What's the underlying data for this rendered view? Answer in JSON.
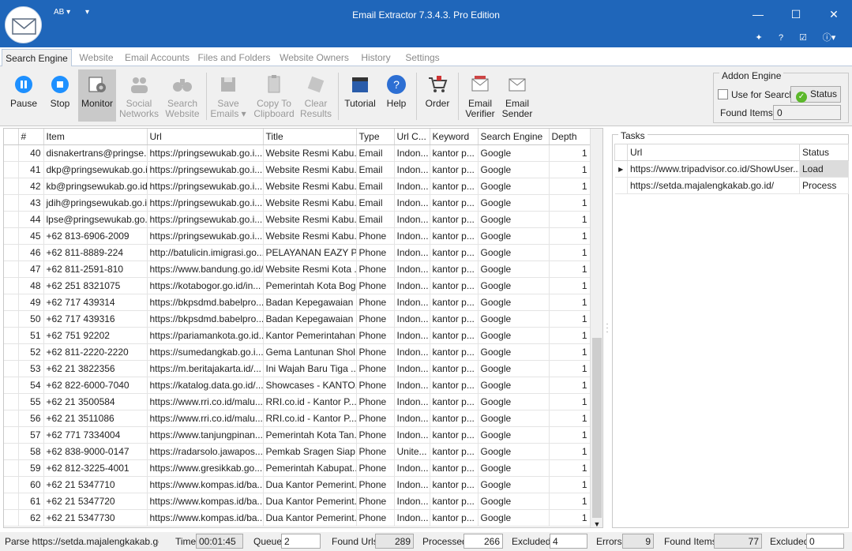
{
  "app": {
    "title": "Email Extractor 7.3.4.3. Pro Edition"
  },
  "titlebar": {
    "quick_access_1": "AB ▾",
    "quick_access_2": "▾",
    "minimize": "—",
    "maximize": "☐",
    "close": "✕"
  },
  "tabs": [
    {
      "label": "Search Engine"
    },
    {
      "label": "Website"
    },
    {
      "label": "Email Accounts"
    },
    {
      "label": "Files and Folders"
    },
    {
      "label": "Website Owners"
    },
    {
      "label": "History"
    },
    {
      "label": "Settings"
    }
  ],
  "ribbon": {
    "pause": "Pause",
    "stop": "Stop",
    "monitor": "Monitor",
    "social_1": "Social",
    "social_2": "Networks",
    "search_1": "Search",
    "search_2": "Website",
    "save_1": "Save",
    "save_2": "Emails ▾",
    "copy_1": "Copy To",
    "copy_2": "Clipboard",
    "clear_1": "Clear",
    "clear_2": "Results",
    "tutorial": "Tutorial",
    "help": "Help",
    "order": "Order",
    "verifier_1": "Email",
    "verifier_2": "Verifier",
    "sender_1": "Email",
    "sender_2": "Sender"
  },
  "addon": {
    "title": "Addon Engine",
    "use_for_search": "Use for Search",
    "status_button": "Status",
    "found_items_label": "Found Items",
    "found_items_value": "0"
  },
  "grid": {
    "headers": [
      "#",
      "Item",
      "Url",
      "Title",
      "Type",
      "Url C...",
      "Keyword",
      "Search Engine",
      "Depth"
    ],
    "rows": [
      [
        "40",
        "disnakertrans@pringse...",
        "https://pringsewukab.go.i...",
        "Website Resmi Kabu...",
        "Email",
        "Indon...",
        "kantor p...",
        "Google",
        "1"
      ],
      [
        "41",
        "dkp@pringsewukab.go.id",
        "https://pringsewukab.go.i...",
        "Website Resmi Kabu...",
        "Email",
        "Indon...",
        "kantor p...",
        "Google",
        "1"
      ],
      [
        "42",
        "kb@pringsewukab.go.id",
        "https://pringsewukab.go.i...",
        "Website Resmi Kabu...",
        "Email",
        "Indon...",
        "kantor p...",
        "Google",
        "1"
      ],
      [
        "43",
        "jdih@pringsewukab.go.id",
        "https://pringsewukab.go.i...",
        "Website Resmi Kabu...",
        "Email",
        "Indon...",
        "kantor p...",
        "Google",
        "1"
      ],
      [
        "44",
        "lpse@pringsewukab.go.id",
        "https://pringsewukab.go.i...",
        "Website Resmi Kabu...",
        "Email",
        "Indon...",
        "kantor p...",
        "Google",
        "1"
      ],
      [
        "45",
        "+62 813-6906-2009",
        "https://pringsewukab.go.i...",
        "Website Resmi Kabu...",
        "Phone",
        "Indon...",
        "kantor p...",
        "Google",
        "1"
      ],
      [
        "46",
        "+62 811-8889-224",
        "http://batulicin.imigrasi.go....",
        "PELAYANAN EAZY P...",
        "Phone",
        "Indon...",
        "kantor p...",
        "Google",
        "1"
      ],
      [
        "47",
        "+62 811-2591-810",
        "https://www.bandung.go.id/",
        "Website Resmi Kota ...",
        "Phone",
        "Indon...",
        "kantor p...",
        "Google",
        "1"
      ],
      [
        "48",
        "+62 251 8321075",
        "https://kotabogor.go.id/in...",
        "Pemerintah Kota Bogor",
        "Phone",
        "Indon...",
        "kantor p...",
        "Google",
        "1"
      ],
      [
        "49",
        "+62 717 439314",
        "https://bkpsdmd.babelpro...",
        "Badan Kepegawaian ...",
        "Phone",
        "Indon...",
        "kantor p...",
        "Google",
        "1"
      ],
      [
        "50",
        "+62 717 439316",
        "https://bkpsdmd.babelpro...",
        "Badan Kepegawaian ...",
        "Phone",
        "Indon...",
        "kantor p...",
        "Google",
        "1"
      ],
      [
        "51",
        "+62 751 92202",
        "https://pariamankota.go.id...",
        "Kantor Pemerintahan...",
        "Phone",
        "Indon...",
        "kantor p...",
        "Google",
        "1"
      ],
      [
        "52",
        "+62 811-2220-2220",
        "https://sumedangkab.go.i...",
        "Gema Lantunan Shol...",
        "Phone",
        "Indon...",
        "kantor p...",
        "Google",
        "1"
      ],
      [
        "53",
        "+62 21 3822356",
        "https://m.beritajakarta.id/...",
        "Ini Wajah Baru Tiga ...",
        "Phone",
        "Indon...",
        "kantor p...",
        "Google",
        "1"
      ],
      [
        "54",
        "+62 822-6000-7040",
        "https://katalog.data.go.id/...",
        "Showcases - KANTO...",
        "Phone",
        "Indon...",
        "kantor p...",
        "Google",
        "1"
      ],
      [
        "55",
        "+62 21 3500584",
        "https://www.rri.co.id/malu...",
        "RRI.co.id - Kantor P...",
        "Phone",
        "Indon...",
        "kantor p...",
        "Google",
        "1"
      ],
      [
        "56",
        "+62 21 3511086",
        "https://www.rri.co.id/malu...",
        "RRI.co.id - Kantor P...",
        "Phone",
        "Indon...",
        "kantor p...",
        "Google",
        "1"
      ],
      [
        "57",
        "+62 771 7334004",
        "https://www.tanjungpinan...",
        "Pemerintah Kota Tan...",
        "Phone",
        "Indon...",
        "kantor p...",
        "Google",
        "1"
      ],
      [
        "58",
        "+62 838-9000-0147",
        "https://radarsolo.jawapos....",
        "Pemkab Sragen Siap...",
        "Phone",
        "Unite...",
        "kantor p...",
        "Google",
        "1"
      ],
      [
        "59",
        "+62 812-3225-4001",
        "https://www.gresikkab.go....",
        "Pemerintah Kabupat...",
        "Phone",
        "Indon...",
        "kantor p...",
        "Google",
        "1"
      ],
      [
        "60",
        "+62 21 5347710",
        "https://www.kompas.id/ba...",
        "Dua Kantor Pemerint...",
        "Phone",
        "Indon...",
        "kantor p...",
        "Google",
        "1"
      ],
      [
        "61",
        "+62 21 5347720",
        "https://www.kompas.id/ba...",
        "Dua Kantor Pemerint...",
        "Phone",
        "Indon...",
        "kantor p...",
        "Google",
        "1"
      ],
      [
        "62",
        "+62 21 5347730",
        "https://www.kompas.id/ba...",
        "Dua Kantor Pemerint...",
        "Phone",
        "Indon...",
        "kantor p...",
        "Google",
        "1"
      ]
    ]
  },
  "tasks": {
    "title": "Tasks",
    "headers": [
      "Url",
      "Status"
    ],
    "rows": [
      [
        "https://www.tripadvisor.co.id/ShowUser...",
        "Load"
      ],
      [
        "https://setda.majalengkakab.go.id/",
        "Process"
      ]
    ]
  },
  "statusbar": {
    "parse": "Parse https://setda.majalengkakab.go.id",
    "time_label": "Time",
    "time_value": "00:01:45",
    "queue_label": "Queue",
    "queue_value": "2",
    "found_urls_label": "Found Urls",
    "found_urls_value": "289",
    "processed_label": "Processed",
    "processed_value": "266",
    "excluded_label": "Excluded",
    "excluded_value": "4",
    "errors_label": "Errors",
    "errors_value": "9",
    "found_items_label": "Found Items",
    "found_items_value": "77",
    "excluded2_label": "Excluded",
    "excluded2_value": "0"
  }
}
